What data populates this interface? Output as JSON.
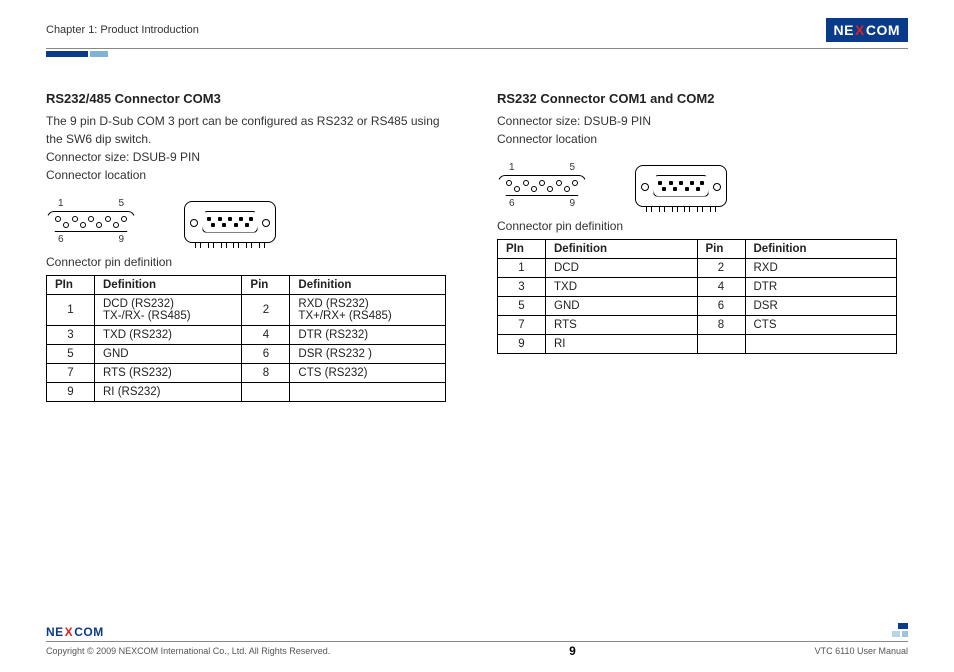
{
  "header": {
    "chapter": "Chapter 1: Product Introduction",
    "logo_pre": "NE",
    "logo_x": "X",
    "logo_post": "COM"
  },
  "left": {
    "title": "RS232/485 Connector COM3",
    "desc1": "The 9 pin D-Sub COM 3 port can be configured as RS232 or RS485 using the SW6 dip switch.",
    "size": "Connector size: DSUB-9 PIN",
    "loc": "Connector location",
    "lbl1": "1",
    "lbl5": "5",
    "lbl6": "6",
    "lbl9": "9",
    "pindef_label": "Connector pin definition",
    "th_pin_a": "PIn",
    "th_def_a": "Definition",
    "th_pin_b": "Pin",
    "th_def_b": "Definition",
    "rows": [
      {
        "pa": "1",
        "da": "DCD (RS232)\nTX-/RX- (RS485)",
        "pb": "2",
        "db": "RXD (RS232)\nTX+/RX+ (RS485)"
      },
      {
        "pa": "3",
        "da": "TXD (RS232)",
        "pb": "4",
        "db": "DTR (RS232)"
      },
      {
        "pa": "5",
        "da": "GND",
        "pb": "6",
        "db": "DSR (RS232 )"
      },
      {
        "pa": "7",
        "da": "RTS (RS232)",
        "pb": "8",
        "db": "CTS (RS232)"
      },
      {
        "pa": "9",
        "da": "RI (RS232)",
        "pb": "",
        "db": ""
      }
    ]
  },
  "right": {
    "title": "RS232 Connector COM1 and COM2",
    "size": "Connector size: DSUB-9 PIN",
    "loc": "Connector location",
    "lbl1": "1",
    "lbl5": "5",
    "lbl6": "6",
    "lbl9": "9",
    "pindef_label": "Connector pin definition",
    "th_pin_a": "PIn",
    "th_def_a": "Definition",
    "th_pin_b": "Pin",
    "th_def_b": "Definition",
    "rows": [
      {
        "pa": "1",
        "da": "DCD",
        "pb": "2",
        "db": "RXD"
      },
      {
        "pa": "3",
        "da": "TXD",
        "pb": "4",
        "db": "DTR"
      },
      {
        "pa": "5",
        "da": "GND",
        "pb": "6",
        "db": "DSR"
      },
      {
        "pa": "7",
        "da": "RTS",
        "pb": "8",
        "db": "CTS"
      },
      {
        "pa": "9",
        "da": "RI",
        "pb": "",
        "db": ""
      }
    ]
  },
  "footer": {
    "logo_pre": "NE",
    "logo_x": "X",
    "logo_post": "COM",
    "copyright": "Copyright © 2009 NEXCOM International Co., Ltd. All Rights Reserved.",
    "page": "9",
    "manual": "VTC 6110 User Manual"
  }
}
